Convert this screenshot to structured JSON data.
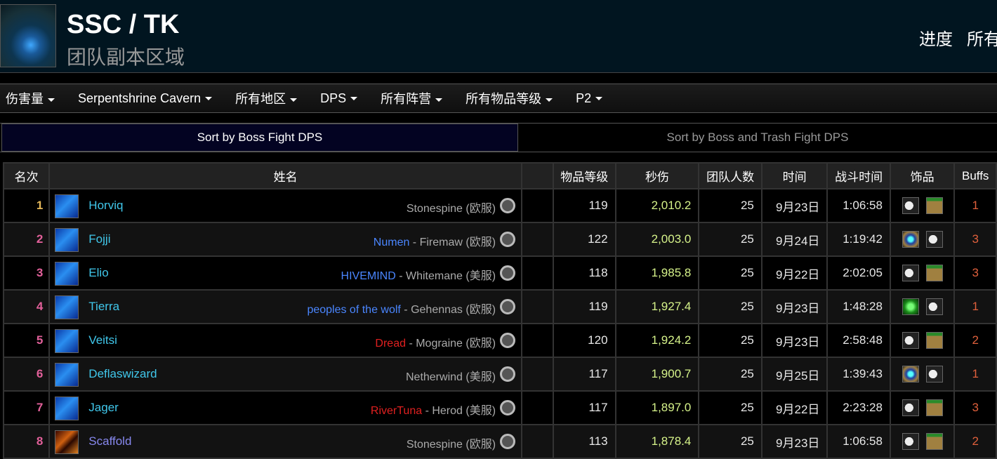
{
  "header": {
    "title": "SSC / TK",
    "subtitle": "团队副本区域",
    "links": [
      "进度",
      "所有"
    ]
  },
  "nav": [
    "伤害量",
    "Serpentshrine Cavern",
    "所有地区",
    "DPS",
    "所有阵营",
    "所有物品等级",
    "P2"
  ],
  "sort_tabs": {
    "active": "Sort by Boss Fight DPS",
    "inactive": "Sort by Boss and Trash Fight DPS"
  },
  "table": {
    "headers": [
      "名次",
      "姓名",
      "",
      "物品等级",
      "秒伤",
      "团队人数",
      "时间",
      "战斗时间",
      "饰品",
      "Buffs"
    ],
    "rows": [
      {
        "rank": "1",
        "name": "Horviq",
        "class": "mage",
        "guild": "",
        "realm": "Stonespine (欧服)",
        "ilvl": "119",
        "dps": "2,010.2",
        "size": "25",
        "date": "9月23日",
        "duration": "1:06:58",
        "trinkets": [
          "crescent",
          "figurine"
        ],
        "buffs": "1"
      },
      {
        "rank": "2",
        "name": "Fojji",
        "class": "mage",
        "guild": "Numen",
        "realm": "Firemaw (欧服)",
        "ilvl": "122",
        "dps": "2,003.0",
        "size": "25",
        "date": "9月24日",
        "duration": "1:19:42",
        "trinkets": [
          "orb",
          "crescent"
        ],
        "buffs": "3"
      },
      {
        "rank": "3",
        "name": "Elio",
        "class": "mage",
        "guild": "HIVEMIND",
        "realm": "Whitemane (美服)",
        "ilvl": "118",
        "dps": "1,985.8",
        "size": "25",
        "date": "9月22日",
        "duration": "2:02:05",
        "trinkets": [
          "crescent",
          "figurine"
        ],
        "buffs": "3"
      },
      {
        "rank": "4",
        "name": "Tierra",
        "class": "mage",
        "guild": "peoples of the wolf",
        "realm": "Gehennas (欧服)",
        "ilvl": "119",
        "dps": "1,927.4",
        "size": "25",
        "date": "9月23日",
        "duration": "1:48:28",
        "trinkets": [
          "green",
          "crescent"
        ],
        "buffs": "1"
      },
      {
        "rank": "5",
        "name": "Veitsi",
        "class": "mage",
        "guild": "Dread",
        "guild_red": true,
        "realm": "Mograine (欧服)",
        "ilvl": "120",
        "dps": "1,924.2",
        "size": "25",
        "date": "9月23日",
        "duration": "2:58:48",
        "trinkets": [
          "crescent",
          "figurine"
        ],
        "buffs": "2"
      },
      {
        "rank": "6",
        "name": "Deflaswizard",
        "class": "mage",
        "guild": "",
        "realm": "Netherwind (美服)",
        "ilvl": "117",
        "dps": "1,900.7",
        "size": "25",
        "date": "9月25日",
        "duration": "1:39:43",
        "trinkets": [
          "orb",
          "crescent"
        ],
        "buffs": "1"
      },
      {
        "rank": "7",
        "name": "Jager",
        "class": "mage",
        "guild": "RiverTuna",
        "guild_red": true,
        "realm": "Herod (美服)",
        "ilvl": "117",
        "dps": "1,897.0",
        "size": "25",
        "date": "9月22日",
        "duration": "2:23:28",
        "trinkets": [
          "crescent",
          "figurine"
        ],
        "buffs": "3"
      },
      {
        "rank": "8",
        "name": "Scaffold",
        "class": "warlock",
        "guild": "",
        "realm": "Stonespine (欧服)",
        "ilvl": "113",
        "dps": "1,878.4",
        "size": "25",
        "date": "9月23日",
        "duration": "1:06:58",
        "trinkets": [
          "crescent",
          "figurine"
        ],
        "buffs": "2"
      }
    ]
  },
  "colors": {
    "rank_first": "#e5b85a",
    "rank_other": "#e2609a",
    "mage": "#40c7eb",
    "warlock": "#8788ee",
    "dps": "#d6f38a",
    "buffs": "#e0603c"
  }
}
